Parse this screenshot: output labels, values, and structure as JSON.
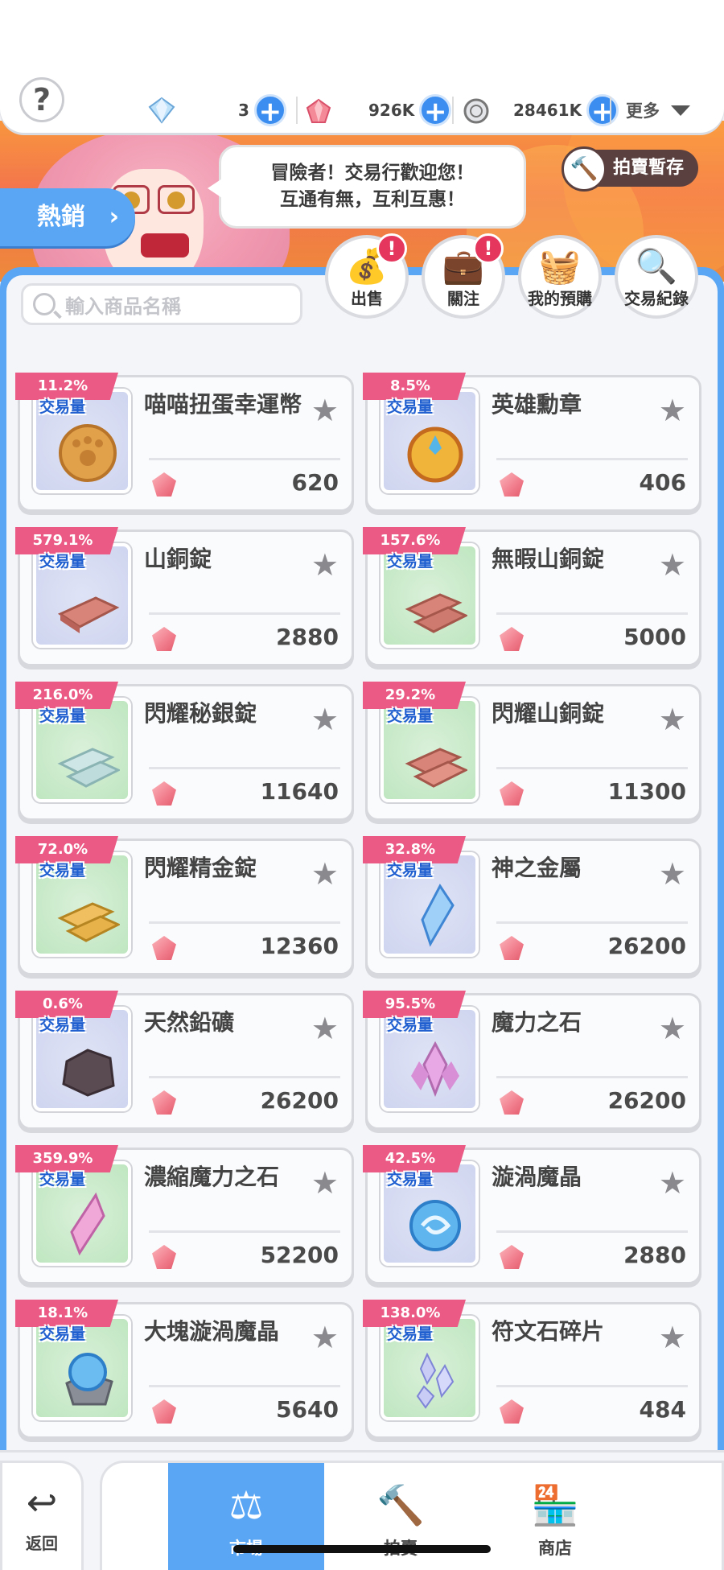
{
  "header": {
    "help_label": "?",
    "currencies": [
      {
        "icon": "diamond-icon",
        "value": "3"
      },
      {
        "icon": "ruby-icon",
        "value": "926K"
      },
      {
        "icon": "coin-icon",
        "value": "28461K"
      }
    ],
    "more_label": "更多"
  },
  "banner": {
    "speech_line1": "冒險者！交易行歡迎您！",
    "speech_line2": "互通有無，互利互惠！",
    "hot_tab_label": "熱銷",
    "auction_stash_label": "拍賣暫存"
  },
  "search": {
    "placeholder": "輸入商品名稱"
  },
  "actions": [
    {
      "label": "出售",
      "icon": "money-bag-icon",
      "badge": "!"
    },
    {
      "label": "關注",
      "icon": "briefcase-star-icon",
      "badge": "!"
    },
    {
      "label": "我的預購",
      "icon": "basket-icon",
      "badge": ""
    },
    {
      "label": "交易紀錄",
      "icon": "record-search-icon",
      "badge": ""
    }
  ],
  "volume_label": "交易量",
  "items": [
    {
      "name": "喵喵扭蛋幸運幣",
      "percent": "11.2%",
      "price": "620",
      "bg": "blue"
    },
    {
      "name": "英雄勳章",
      "percent": "8.5%",
      "price": "406",
      "bg": "blue"
    },
    {
      "name": "山銅錠",
      "percent": "579.1%",
      "price": "2880",
      "bg": "blue"
    },
    {
      "name": "無暇山銅錠",
      "percent": "157.6%",
      "price": "5000",
      "bg": "green"
    },
    {
      "name": "閃耀秘銀錠",
      "percent": "216.0%",
      "price": "11640",
      "bg": "green"
    },
    {
      "name": "閃耀山銅錠",
      "percent": "29.2%",
      "price": "11300",
      "bg": "green"
    },
    {
      "name": "閃耀精金錠",
      "percent": "72.0%",
      "price": "12360",
      "bg": "green"
    },
    {
      "name": "神之金屬",
      "percent": "32.8%",
      "price": "26200",
      "bg": "blue"
    },
    {
      "name": "天然鉛礦",
      "percent": "0.6%",
      "price": "26200",
      "bg": "blue"
    },
    {
      "name": "魔力之石",
      "percent": "95.5%",
      "price": "26200",
      "bg": "blue"
    },
    {
      "name": "濃縮魔力之石",
      "percent": "359.9%",
      "price": "52200",
      "bg": "green"
    },
    {
      "name": "漩渦魔晶",
      "percent": "42.5%",
      "price": "2880",
      "bg": "blue"
    },
    {
      "name": "大塊漩渦魔晶",
      "percent": "18.1%",
      "price": "5640",
      "bg": "green"
    },
    {
      "name": "符文石碎片",
      "percent": "138.0%",
      "price": "484",
      "bg": "green"
    }
  ],
  "nav": {
    "back_label": "返回",
    "tabs": [
      {
        "label": "市場",
        "icon": "scale-icon",
        "active": true
      },
      {
        "label": "拍賣",
        "icon": "gavel-icon",
        "active": false
      },
      {
        "label": "商店",
        "icon": "shop-icon",
        "active": false
      }
    ]
  },
  "colors": {
    "accent_blue": "#5aa6f5",
    "ribbon_pink": "#ea5a84",
    "volume_text_blue": "#1f5fcf",
    "banner_orange": "#f3734d"
  }
}
